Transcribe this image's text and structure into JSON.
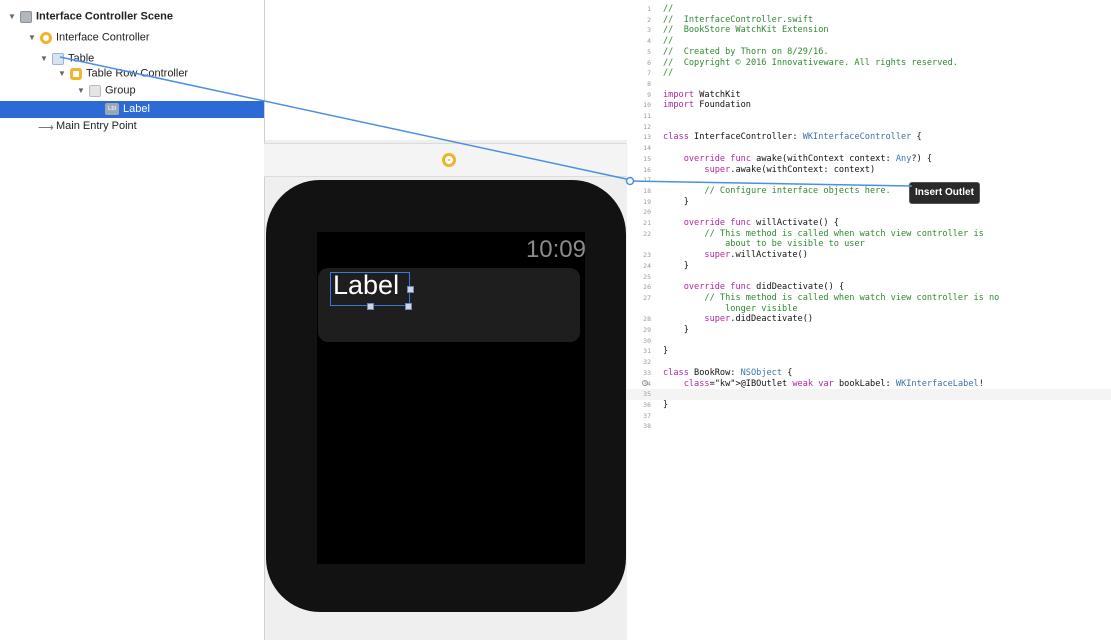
{
  "outline": {
    "items": [
      {
        "label": "Interface Controller Scene",
        "icon": "scene-icon"
      },
      {
        "label": "Interface Controller",
        "icon": "interface-controller-icon"
      },
      {
        "label": "Table",
        "icon": "table-icon"
      },
      {
        "label": "Table Row Controller",
        "icon": "table-row-controller-icon"
      },
      {
        "label": "Group",
        "icon": "group-icon"
      },
      {
        "label": "Label",
        "icon": "label-icon",
        "selected": true
      },
      {
        "label": "Main Entry Point",
        "icon": "entry-arrow-icon"
      }
    ]
  },
  "canvas": {
    "time": "10:09",
    "label_text": "Label"
  },
  "code": {
    "lines": [
      {
        "n": "1",
        "t": "//"
      },
      {
        "n": "2",
        "t": "//  InterfaceController.swift"
      },
      {
        "n": "3",
        "t": "//  BookStore WatchKit Extension"
      },
      {
        "n": "4",
        "t": "//"
      },
      {
        "n": "5",
        "t": "//  Created by Thorn on 8/29/16."
      },
      {
        "n": "6",
        "t": "//  Copyright © 2016 Innovativeware. All rights reserved."
      },
      {
        "n": "7",
        "t": "//"
      },
      {
        "n": "8",
        "t": ""
      },
      {
        "n": "9",
        "t": "import WatchKit"
      },
      {
        "n": "10",
        "t": "import Foundation"
      },
      {
        "n": "11",
        "t": ""
      },
      {
        "n": "12",
        "t": ""
      },
      {
        "n": "13",
        "t": "class InterfaceController: WKInterfaceController {"
      },
      {
        "n": "14",
        "t": ""
      },
      {
        "n": "15",
        "t": "    override func awake(withContext context: Any?) {"
      },
      {
        "n": "16",
        "t": "        super.awake(withContext: context)"
      },
      {
        "n": "17",
        "t": ""
      },
      {
        "n": "18",
        "t": "        // Configure interface objects here."
      },
      {
        "n": "19",
        "t": "    }"
      },
      {
        "n": "20",
        "t": ""
      },
      {
        "n": "21",
        "t": "    override func willActivate() {"
      },
      {
        "n": "22",
        "t": "        // This method is called when watch view controller is"
      },
      {
        "n": "",
        "t": "            about to be visible to user"
      },
      {
        "n": "23",
        "t": "        super.willActivate()"
      },
      {
        "n": "24",
        "t": "    }"
      },
      {
        "n": "25",
        "t": ""
      },
      {
        "n": "26",
        "t": "    override func didDeactivate() {"
      },
      {
        "n": "27",
        "t": "        // This method is called when watch view controller is no"
      },
      {
        "n": "",
        "t": "            longer visible"
      },
      {
        "n": "28",
        "t": "        super.didDeactivate()"
      },
      {
        "n": "29",
        "t": "    }"
      },
      {
        "n": "30",
        "t": ""
      },
      {
        "n": "31",
        "t": "}"
      },
      {
        "n": "32",
        "t": ""
      },
      {
        "n": "33",
        "t": "class BookRow: NSObject {"
      },
      {
        "n": "34",
        "t": "    @IBOutlet weak var bookLabel: WKInterfaceLabel!"
      },
      {
        "n": "35",
        "t": ""
      },
      {
        "n": "36",
        "t": "}"
      },
      {
        "n": "37",
        "t": ""
      },
      {
        "n": "38",
        "t": ""
      }
    ]
  },
  "tooltip": "Insert Outlet",
  "colors": {
    "selection": "#2c6ad6",
    "connector": "#4a90e2",
    "keyword": "#b0279e",
    "comment": "#2e8a2e",
    "type": "#3a73ad"
  }
}
